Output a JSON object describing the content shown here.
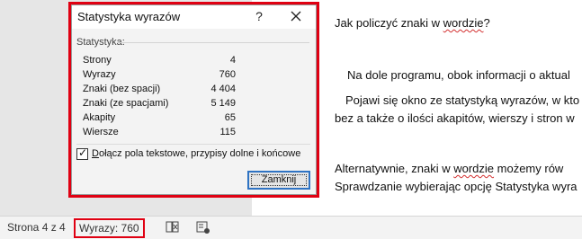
{
  "document": {
    "line1": "Jak policzyć znaki w ",
    "line1_squiggle": "wordzie",
    "line1_end": "?",
    "line2": "Na dole programu, obok informacji o aktual",
    "line3": "Pojawi się okno ze statystyką wyrazów, w kto",
    "line4": "bez a także o ilości akapitów, wierszy i stron w",
    "line5_start": "Alternatywnie, znaki w ",
    "line5_squiggle": "wordzie",
    "line5_end": " możemy rów",
    "line6": "Sprawdzanie wybierając opcję Statystyka wyra"
  },
  "dialog": {
    "title": "Statystyka wyrazów",
    "help_label": "?",
    "group_label": "Statystyka:",
    "stats": [
      {
        "label": "Strony",
        "value": "4"
      },
      {
        "label": "Wyrazy",
        "value": "760"
      },
      {
        "label": "Znaki (bez spacji)",
        "value": "4 404"
      },
      {
        "label": "Znaki (ze spacjami)",
        "value": "5 149"
      },
      {
        "label": "Akapity",
        "value": "65"
      },
      {
        "label": "Wiersze",
        "value": "115"
      }
    ],
    "checkbox_checked": true,
    "checkbox_mark": "✓",
    "checkbox_label_first": "D",
    "checkbox_label_rest": "ołącz pola tekstowe, przypisy dolne i końcowe",
    "close_button_label": "Zamknij"
  },
  "status_bar": {
    "page_info": "Strona 4 z 4",
    "word_count": "Wyrazy: 760"
  },
  "colors": {
    "highlight": "#e00012",
    "focus_blue": "#2f73c3"
  }
}
